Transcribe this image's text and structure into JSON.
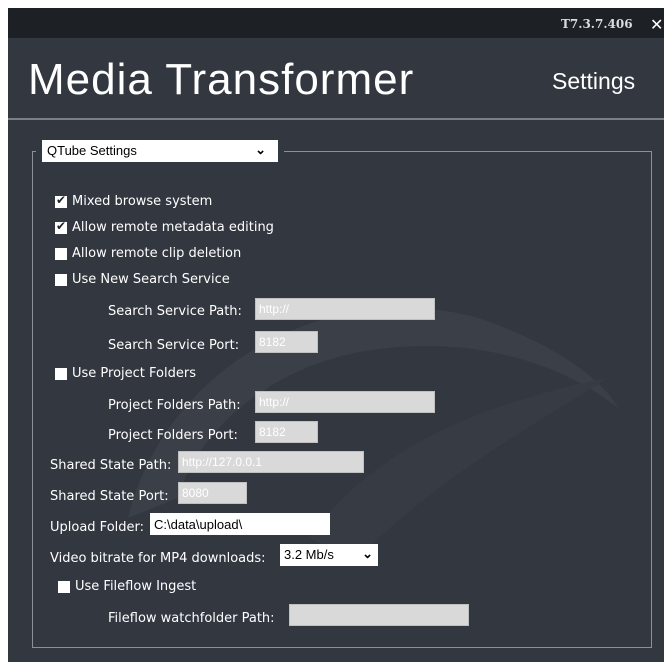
{
  "app": {
    "version": "T7.3.7.406",
    "close_glyph": "✕",
    "title": "Media Transformer",
    "section": "Settings"
  },
  "group": {
    "selected": "QTube Settings"
  },
  "options": {
    "mixed_browse": {
      "label": "Mixed browse system",
      "checked": true
    },
    "remote_metadata": {
      "label": "Allow remote metadata editing",
      "checked": true
    },
    "remote_delete": {
      "label": "Allow remote clip deletion",
      "checked": false
    },
    "new_search": {
      "label": "Use New Search Service",
      "checked": false
    },
    "project_folders": {
      "label": "Use Project Folders",
      "checked": false
    },
    "fileflow": {
      "label": "Use Fileflow Ingest",
      "checked": false
    }
  },
  "fields": {
    "search_path": {
      "label": "Search Service Path:",
      "placeholder": "http://"
    },
    "search_port": {
      "label": "Search Service Port:",
      "placeholder": "8182"
    },
    "project_path": {
      "label": "Project Folders Path:",
      "placeholder": "http://"
    },
    "project_port": {
      "label": "Project Folders Port:",
      "placeholder": "8182"
    },
    "shared_path": {
      "label": "Shared State Path:",
      "placeholder": "http://127.0.0.1"
    },
    "shared_port": {
      "label": "Shared State Port:",
      "placeholder": "8080"
    },
    "upload": {
      "label": "Upload Folder:",
      "value": "C:\\data\\upload\\"
    },
    "bitrate": {
      "label": "Video bitrate for MP4 downloads:",
      "value": "3.2 Mb/s"
    },
    "watchfolder": {
      "label": "Fileflow watchfolder Path:",
      "value": ""
    }
  },
  "icons": {
    "check": "✔",
    "chevron": "⌄"
  },
  "colors": {
    "background": "#323740",
    "topbar": "#1d2126",
    "disabled_field": "#d9d9d9"
  }
}
